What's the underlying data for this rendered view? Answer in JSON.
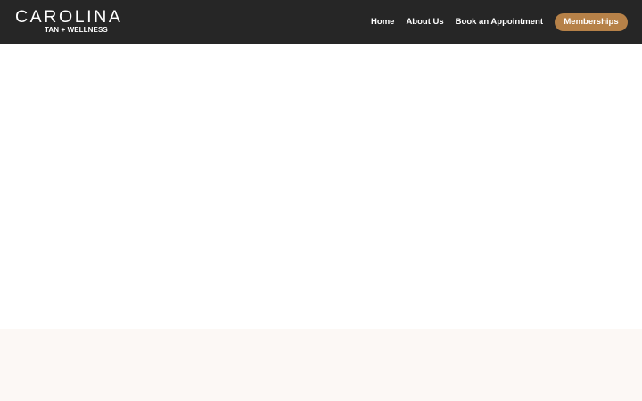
{
  "header": {
    "logo": {
      "title": "CAROLINA",
      "subtitle": "TAN + WELLNESS"
    },
    "nav": {
      "items": [
        {
          "label": "Home"
        },
        {
          "label": "About Us"
        },
        {
          "label": "Book an Appointment"
        }
      ],
      "cta_label": "Memberships"
    }
  },
  "colors": {
    "header_background": "#262626",
    "accent": "#b68148",
    "section_background": "#fcf8f5"
  }
}
